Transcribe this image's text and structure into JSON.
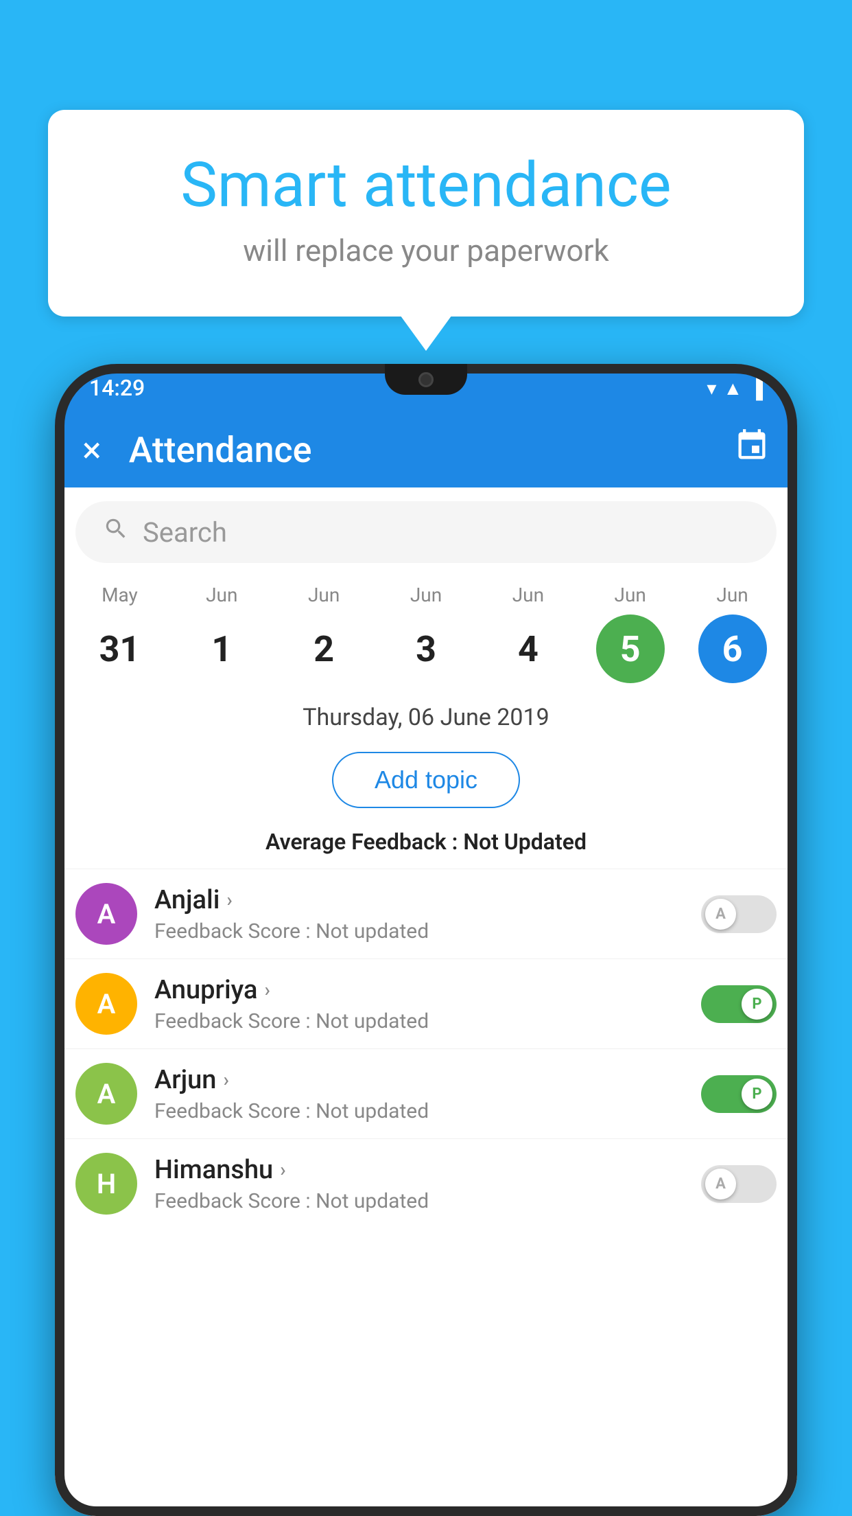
{
  "background_color": "#29B6F6",
  "speech_bubble": {
    "title": "Smart attendance",
    "subtitle": "will replace your paperwork"
  },
  "status_bar": {
    "time": "14:29",
    "icons": [
      "wifi",
      "signal",
      "battery"
    ]
  },
  "app_bar": {
    "title": "Attendance",
    "close_label": "×",
    "calendar_label": "📅"
  },
  "search": {
    "placeholder": "Search"
  },
  "calendar": {
    "days": [
      {
        "month": "May",
        "date": "31",
        "style": "normal"
      },
      {
        "month": "Jun",
        "date": "1",
        "style": "normal"
      },
      {
        "month": "Jun",
        "date": "2",
        "style": "normal"
      },
      {
        "month": "Jun",
        "date": "3",
        "style": "normal"
      },
      {
        "month": "Jun",
        "date": "4",
        "style": "normal"
      },
      {
        "month": "Jun",
        "date": "5",
        "style": "today"
      },
      {
        "month": "Jun",
        "date": "6",
        "style": "selected"
      }
    ]
  },
  "selected_date_label": "Thursday, 06 June 2019",
  "add_topic_button": "Add topic",
  "average_feedback": {
    "label": "Average Feedback : ",
    "value": "Not Updated"
  },
  "students": [
    {
      "name": "Anjali",
      "avatar_letter": "A",
      "avatar_color": "#AB47BC",
      "feedback_label": "Feedback Score : ",
      "feedback_value": "Not updated",
      "toggle": "off",
      "toggle_label": "A"
    },
    {
      "name": "Anupriya",
      "avatar_letter": "A",
      "avatar_color": "#FFB300",
      "feedback_label": "Feedback Score : ",
      "feedback_value": "Not updated",
      "toggle": "on",
      "toggle_label": "P"
    },
    {
      "name": "Arjun",
      "avatar_letter": "A",
      "avatar_color": "#8BC34A",
      "feedback_label": "Feedback Score : ",
      "feedback_value": "Not updated",
      "toggle": "on",
      "toggle_label": "P"
    },
    {
      "name": "Himanshu",
      "avatar_letter": "H",
      "avatar_color": "#8BC34A",
      "feedback_label": "Feedback Score : ",
      "feedback_value": "Not updated",
      "toggle": "off",
      "toggle_label": "A"
    }
  ]
}
